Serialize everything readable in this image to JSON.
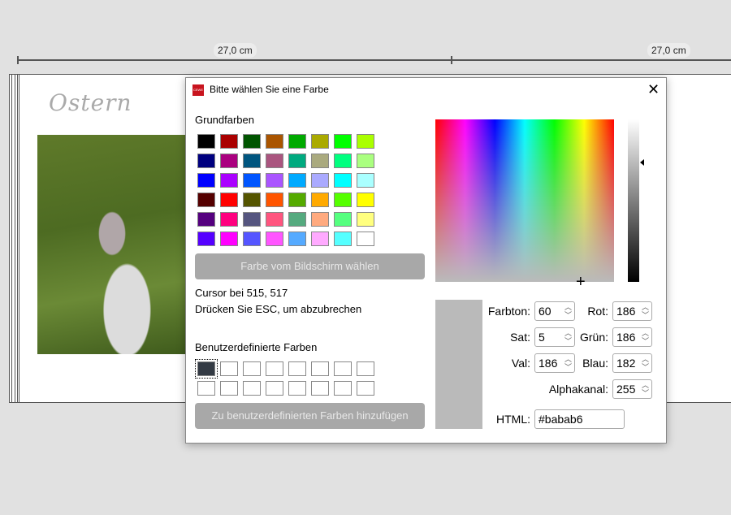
{
  "ruler": {
    "left_label": "27,0 cm",
    "right_label": "27,0 cm"
  },
  "page": {
    "title": "Ostern"
  },
  "dialog": {
    "title": "Bitte wählen Sie eine Farbe",
    "basic_colors_label": "Grundfarben",
    "basic_colors": [
      [
        "#000000",
        "#aa0000",
        "#005500",
        "#aa5500",
        "#00aa00",
        "#aaaa00",
        "#00ff00",
        "#aaff00"
      ],
      [
        "#00007f",
        "#aa007f",
        "#00557f",
        "#aa557f",
        "#00aa7f",
        "#aaaa7f",
        "#00ff7f",
        "#aaff7f"
      ],
      [
        "#0000ff",
        "#aa00ff",
        "#0055ff",
        "#aa55ff",
        "#00aaff",
        "#aaaaff",
        "#00ffff",
        "#aaffff"
      ],
      [
        "#550000",
        "#ff0000",
        "#555500",
        "#ff5500",
        "#55aa00",
        "#ffaa00",
        "#55ff00",
        "#ffff00"
      ],
      [
        "#55007f",
        "#ff007f",
        "#55557f",
        "#ff557f",
        "#55aa7f",
        "#ffaa7f",
        "#55ff7f",
        "#ffff7f"
      ],
      [
        "#5500ff",
        "#ff00ff",
        "#5555ff",
        "#ff55ff",
        "#55aaff",
        "#ffaaff",
        "#55ffff",
        "#ffffff"
      ]
    ],
    "pick_screen_button": "Farbe vom Bildschirm wählen",
    "cursor_text": "Cursor bei 515, 517",
    "esc_text": "Drücken Sie ESC, um abzubrechen",
    "custom_colors_label": "Benutzerdefinierte Farben",
    "custom_selected_color": "#333a44",
    "add_custom_button": "Zu benutzerdefinierten Farben hinzufügen",
    "fields": {
      "hue": {
        "label": "Farbton:",
        "value": "60"
      },
      "sat": {
        "label": "Sat:",
        "value": "5"
      },
      "val": {
        "label": "Val:",
        "value": "186"
      },
      "red": {
        "label": "Rot:",
        "value": "186"
      },
      "green": {
        "label": "Grün:",
        "value": "186"
      },
      "blue": {
        "label": "Blau:",
        "value": "182"
      },
      "alpha": {
        "label": "Alphakanal:",
        "value": "255"
      },
      "html": {
        "label": "HTML:",
        "value": "#babab6"
      }
    },
    "current_color": "#bababa"
  }
}
